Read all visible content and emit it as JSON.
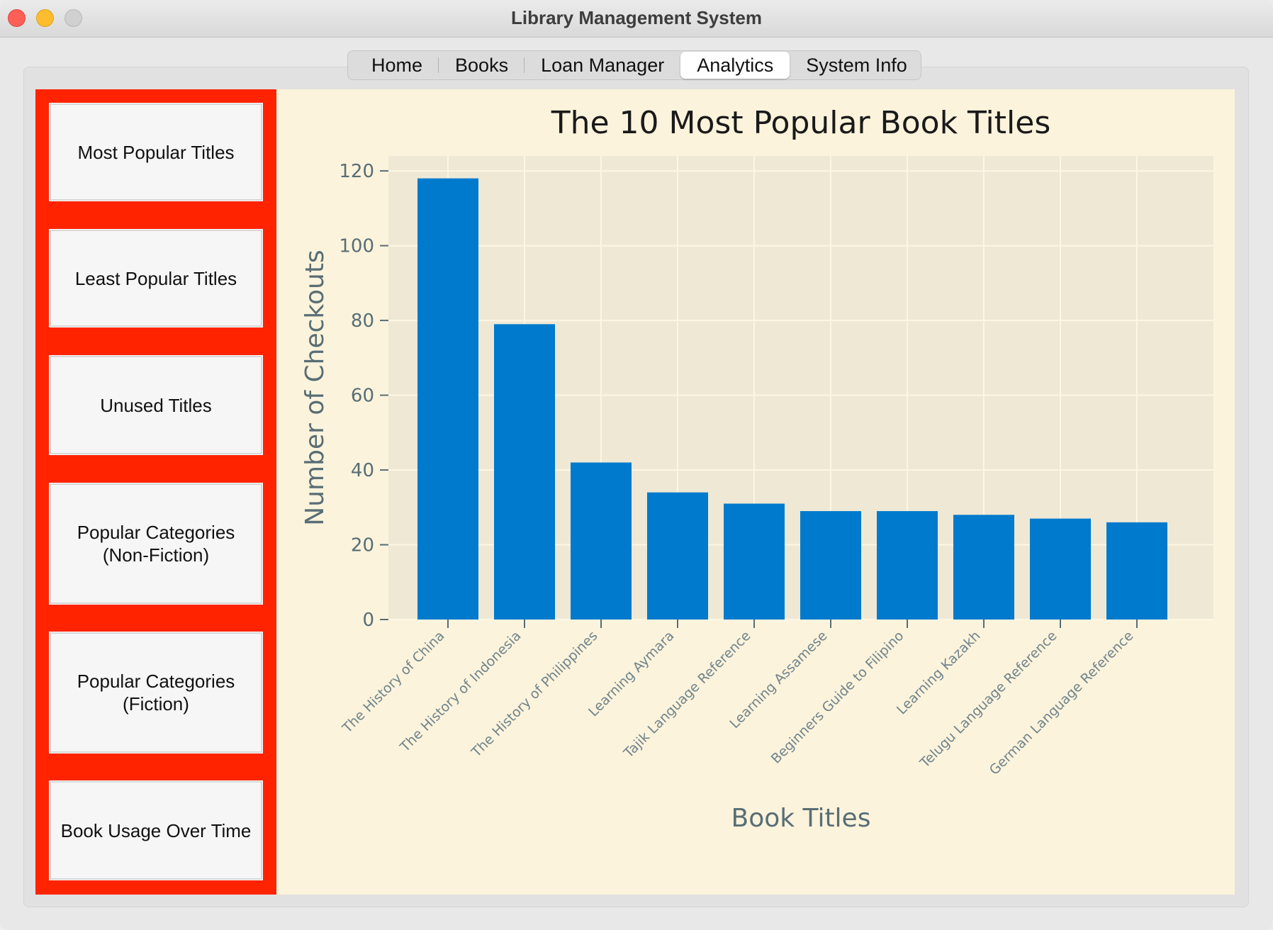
{
  "window": {
    "title": "Library Management System"
  },
  "tabs": [
    {
      "label": "Home",
      "active": false
    },
    {
      "label": "Books",
      "active": false
    },
    {
      "label": "Loan Manager",
      "active": false
    },
    {
      "label": "Analytics",
      "active": true
    },
    {
      "label": "System Info",
      "active": false
    }
  ],
  "sidebar": {
    "color": "#ff2300",
    "buttons": [
      {
        "label": "Most Popular Titles"
      },
      {
        "label": "Least Popular Titles"
      },
      {
        "label": "Unused Titles"
      },
      {
        "label": "Popular Categories\n(Non-Fiction)"
      },
      {
        "label": "Popular Categories\n(Fiction)"
      },
      {
        "label": "Book Usage Over Time"
      }
    ]
  },
  "chart_data": {
    "type": "bar",
    "title": "The 10 Most Popular Book Titles",
    "xlabel": "Book Titles",
    "ylabel": "Number of Checkouts",
    "categories": [
      "The History of China",
      "The History of Indonesia",
      "The History of Philippines",
      "Learning Aymara",
      "Tajik Language Reference",
      "Learning Assamese",
      "Beginners Guide to Filipino",
      "Learning Kazakh",
      "Telugu Language Reference",
      "German Language Reference"
    ],
    "values": [
      118,
      79,
      42,
      34,
      31,
      29,
      29,
      28,
      27,
      26
    ],
    "ylim": [
      0,
      124
    ],
    "yticks": [
      0,
      20,
      40,
      60,
      80,
      100,
      120
    ],
    "grid": true,
    "bar_color": "#007acc",
    "plot_background": "#eee8d5",
    "figure_background": "#fcf3dc"
  }
}
